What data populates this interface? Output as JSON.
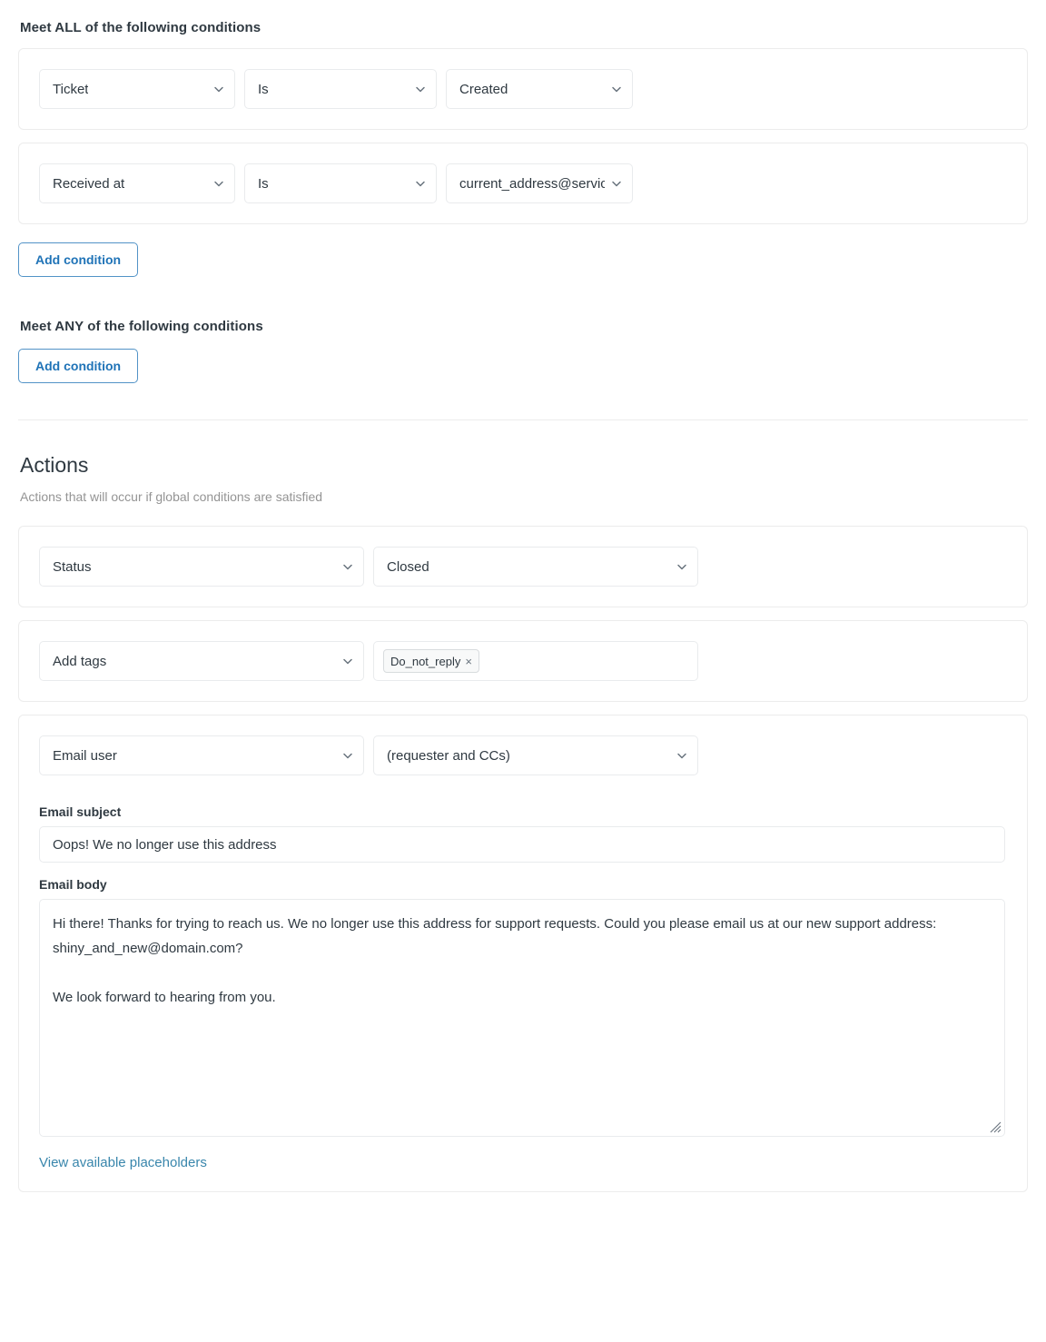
{
  "conditions_all": {
    "heading": "Meet ALL of the following conditions",
    "rows": [
      {
        "field": "Ticket",
        "operator": "Is",
        "value": "Created"
      },
      {
        "field": "Received at",
        "operator": "Is",
        "value": "current_address@service.com"
      }
    ],
    "add_condition_label": "Add condition"
  },
  "conditions_any": {
    "heading": "Meet ANY of the following conditions",
    "add_condition_label": "Add condition"
  },
  "actions": {
    "title": "Actions",
    "subtitle": "Actions that will occur if global conditions are satisfied",
    "status_action": {
      "field": "Status",
      "value": "Closed"
    },
    "tags_action": {
      "field": "Add tags",
      "tags": [
        {
          "label": "Do_not_reply",
          "remove": "×"
        }
      ]
    },
    "email_action": {
      "field": "Email user",
      "recipient": "(requester and CCs)",
      "subject_label": "Email subject",
      "subject_value": "Oops! We no longer use this address",
      "body_label": "Email body",
      "body_value": "Hi there! Thanks for trying to reach us. We no longer use this address for support requests. Could you please email us at our new support address: shiny_and_new@domain.com?\n\nWe look forward to hearing from you.",
      "placeholders_link": "View available placeholders"
    }
  },
  "colors": {
    "accent_blue": "#1f73b7",
    "link_blue": "#3986ac",
    "text": "#2f3941",
    "muted": "#949494",
    "border": "#e9ebed",
    "card_border": "#ececec"
  }
}
